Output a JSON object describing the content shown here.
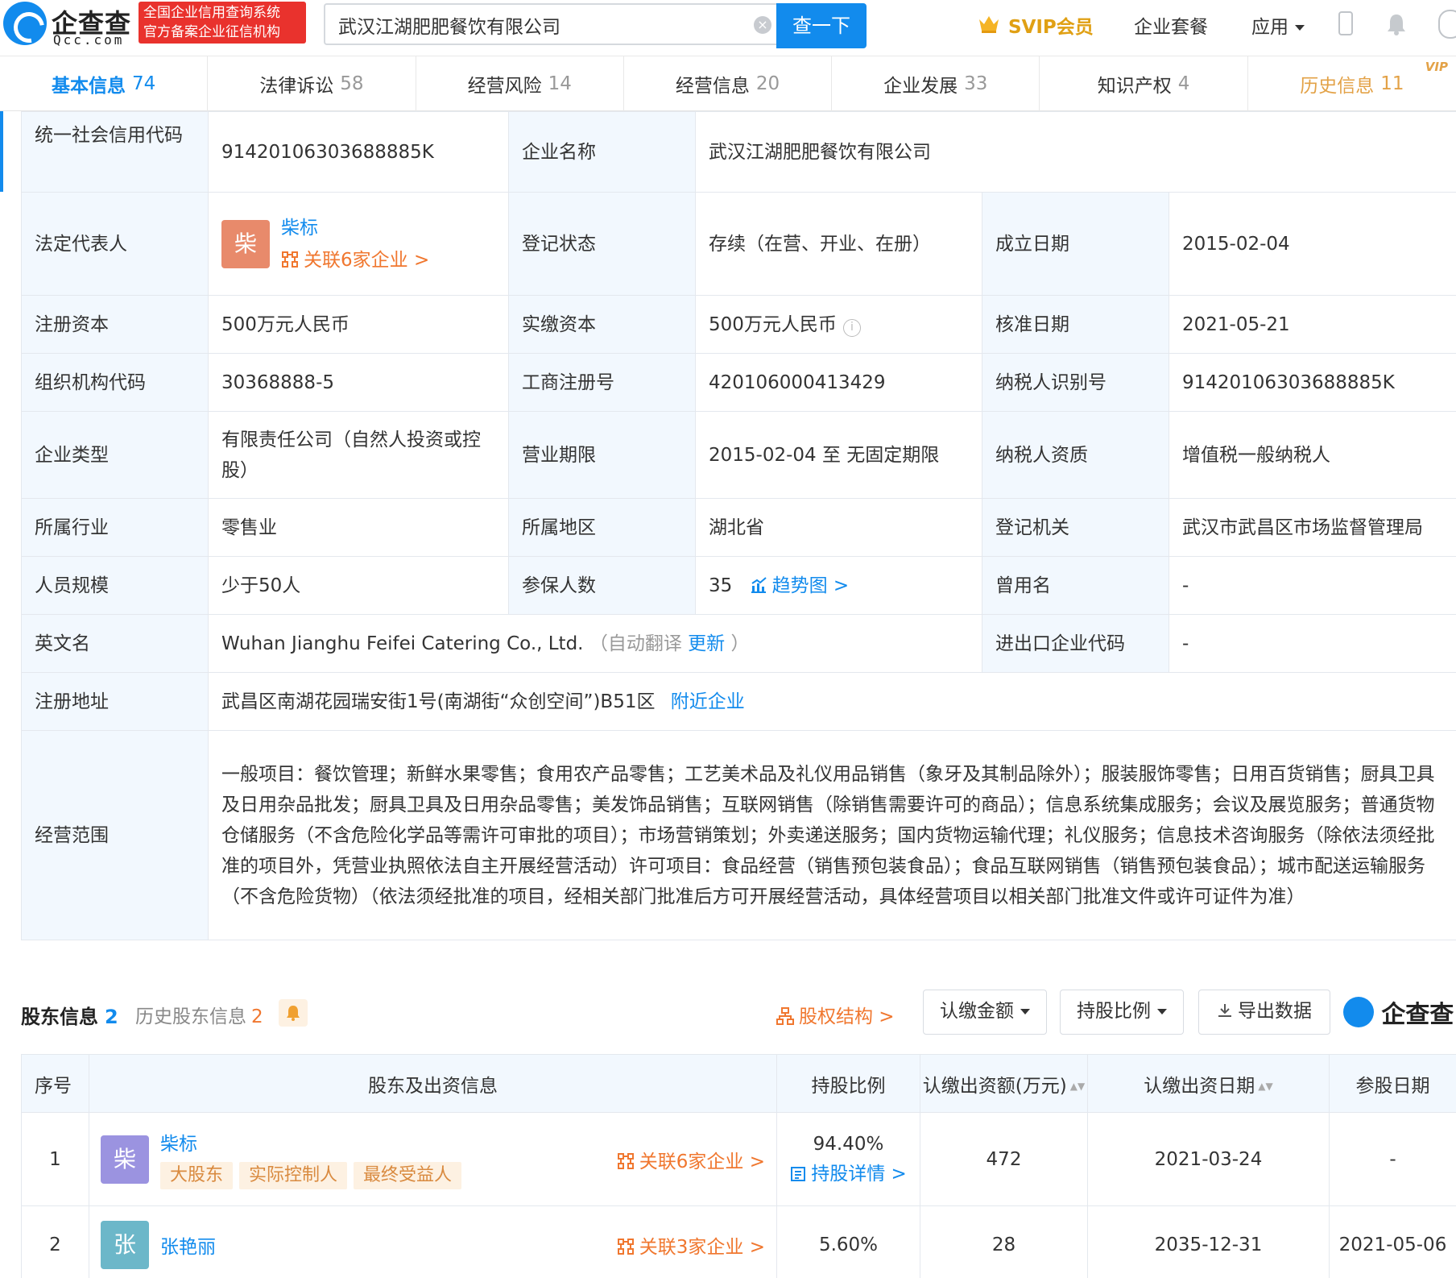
{
  "header": {
    "logo_name": "企查查",
    "logo_domain": "Qcc.com",
    "badge_line1": "全国企业信用查询系统",
    "badge_line2": "官方备案企业征信机构",
    "search_value": "武汉江湖肥肥餐饮有限公司",
    "search_button": "查一下",
    "svip": "SVIP会员",
    "packages": "企业套餐",
    "apps": "应用",
    "clear_glyph": "×"
  },
  "tabs": [
    {
      "label": "基本信息",
      "count": "74"
    },
    {
      "label": "法律诉讼",
      "count": "58"
    },
    {
      "label": "经营风险",
      "count": "14"
    },
    {
      "label": "经营信息",
      "count": "20"
    },
    {
      "label": "企业发展",
      "count": "33"
    },
    {
      "label": "知识产权",
      "count": "4"
    },
    {
      "label": "历史信息",
      "count": "11",
      "vip": "VIP"
    }
  ],
  "info": {
    "credit_code_label": "统一社会信用代码",
    "credit_code": "91420106303688885K",
    "company_name_label": "企业名称",
    "company_name": "武汉江湖肥肥餐饮有限公司",
    "legal_rep_label": "法定代表人",
    "legal_rep_avatar": "柴",
    "legal_rep_name": "柴标",
    "legal_rep_related": "关联6家企业 >",
    "status_label": "登记状态",
    "status": "存续（在营、开业、在册）",
    "founded_label": "成立日期",
    "founded": "2015-02-04",
    "reg_capital_label": "注册资本",
    "reg_capital": "500万元人民币",
    "paid_capital_label": "实缴资本",
    "paid_capital": "500万元人民币",
    "info_glyph": "i",
    "approved_label": "核准日期",
    "approved": "2021-05-21",
    "org_code_label": "组织机构代码",
    "org_code": "30368888-5",
    "biz_reg_label": "工商注册号",
    "biz_reg": "420106000413429",
    "taxpayer_id_label": "纳税人识别号",
    "taxpayer_id": "91420106303688885K",
    "type_label": "企业类型",
    "type": "有限责任公司（自然人投资或控股）",
    "term_label": "营业期限",
    "term": "2015-02-04 至 无固定期限",
    "taxpayer_q_label": "纳税人资质",
    "taxpayer_q": "增值税一般纳税人",
    "industry_label": "所属行业",
    "industry": "零售业",
    "region_label": "所属地区",
    "region": "湖北省",
    "authority_label": "登记机关",
    "authority": "武汉市武昌区市场监督管理局",
    "staff_label": "人员规模",
    "staff": "少于50人",
    "insured_label": "参保人数",
    "insured": "35",
    "trend": "趋势图 >",
    "former_name_label": "曾用名",
    "former_name": "-",
    "english_label": "英文名",
    "english": "Wuhan Jianghu Feifei Catering Co., Ltd.",
    "auto_translate": "（自动翻译",
    "update": "更新",
    "auto_translate_end": "）",
    "ie_code_label": "进出口企业代码",
    "ie_code": "-",
    "address_label": "注册地址",
    "address": "武昌区南湖花园瑞安街1号(南湖街“众创空间”)B51区",
    "nearby": "附近企业",
    "scope_label": "经营范围",
    "scope": "一般项目：餐饮管理；新鲜水果零售；食用农产品零售；工艺美术品及礼仪用品销售（象牙及其制品除外）；服装服饰零售；日用百货销售；厨具卫具及日用杂品批发；厨具卫具及日用杂品零售；美发饰品销售；互联网销售（除销售需要许可的商品）；信息系统集成服务；会议及展览服务；普通货物仓储服务（不含危险化学品等需许可审批的项目）；市场营销策划；外卖递送服务；国内货物运输代理；礼仪服务；信息技术咨询服务（除依法须经批准的项目外，凭营业执照依法自主开展经营活动）许可项目：食品经营（销售预包装食品）；食品互联网销售（销售预包装食品）；城市配送运输服务（不含危险货物）（依法须经批准的项目，经相关部门批准后方可开展经营活动，具体经营项目以相关部门批准文件或许可证件为准）"
  },
  "shareholders": {
    "title": "股东信息",
    "count": "2",
    "history_label": "历史股东信息",
    "history_count": "2",
    "equity_structure": "股权结构 >",
    "btn_amount": "认缴金额",
    "btn_ratio": "持股比例",
    "btn_export": "导出数据",
    "brand": "企查查",
    "columns": [
      "序号",
      "股东及出资信息",
      "持股比例",
      "认缴出资额(万元)",
      "认缴出资日期",
      "参股日期"
    ],
    "sort_glyph": "▲▼",
    "rows": [
      {
        "no": "1",
        "avatar": "柴",
        "name": "柴标",
        "tags": [
          "大股东",
          "实际控制人",
          "最终受益人"
        ],
        "related": "关联6家企业 >",
        "ratio": "94.40%",
        "detail": "持股详情 >",
        "amount": "472",
        "date": "2021-03-24",
        "join": "-"
      },
      {
        "no": "2",
        "avatar": "张",
        "name": "张艳丽",
        "tags": [],
        "related": "关联3家企业 >",
        "ratio": "5.60%",
        "detail": "",
        "amount": "28",
        "date": "2035-12-31",
        "join": "2021-05-06"
      }
    ]
  },
  "colors": {
    "primary": "#128bed",
    "orange": "#f0772f",
    "red_badge": "#e9322d",
    "label_bg": "#f2f8fe",
    "avatar_legal": "#e88a6b",
    "avatar_1": "#9b93e0",
    "avatar_2": "#6cb7c9"
  }
}
